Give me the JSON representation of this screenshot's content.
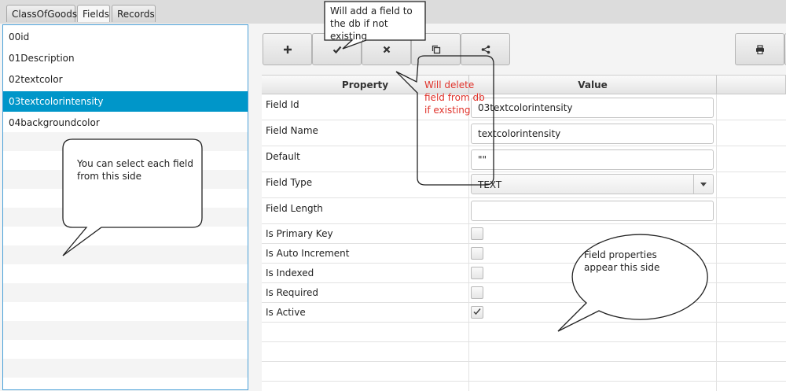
{
  "tabs": [
    {
      "label": "ClassOfGoods"
    },
    {
      "label": "Fields",
      "active": true
    },
    {
      "label": "Records"
    }
  ],
  "fields_list": {
    "items": [
      "00id",
      "01Description",
      "02textcolor",
      "03textcolorintensity",
      "04backgroundcolor"
    ],
    "selected": "03textcolorintensity"
  },
  "toolbar": {
    "buttons": [
      {
        "name": "add-field-button",
        "icon": "plus-icon"
      },
      {
        "name": "save-field-button",
        "icon": "check-icon"
      },
      {
        "name": "delete-field-button",
        "icon": "close-icon"
      },
      {
        "name": "copy-field-button",
        "icon": "copy-icon"
      },
      {
        "name": "share-field-button",
        "icon": "share-icon"
      },
      {
        "name": "print-button",
        "icon": "print-icon"
      }
    ]
  },
  "properties": {
    "header_property": "Property",
    "header_value": "Value",
    "rows": {
      "field_id": {
        "label": "Field Id",
        "value": "03textcolorintensity"
      },
      "field_name": {
        "label": "Field Name",
        "value": "textcolorintensity"
      },
      "default": {
        "label": "Default",
        "value": "\"\""
      },
      "field_type": {
        "label": "Field Type",
        "value": "TEXT"
      },
      "field_length": {
        "label": "Field Length",
        "value": ""
      },
      "is_primary_key": {
        "label": "Is Primary Key",
        "checked": false
      },
      "is_auto_increment": {
        "label": "Is Auto Increment",
        "checked": false
      },
      "is_indexed": {
        "label": "Is Indexed",
        "checked": false
      },
      "is_required": {
        "label": "Is Required",
        "checked": false
      },
      "is_active": {
        "label": "Is Active",
        "checked": true
      }
    }
  },
  "annotations": {
    "add_note": "Will add a field to the db if not existing",
    "delete_note": "Will delete field from db if existing",
    "select_note": "You can select each field from this side",
    "properties_note": "Field properties appear this side",
    "accent_color": "#e0322a"
  },
  "colors": {
    "selection": "#0096c9",
    "focus_border": "#4aa0d8"
  }
}
